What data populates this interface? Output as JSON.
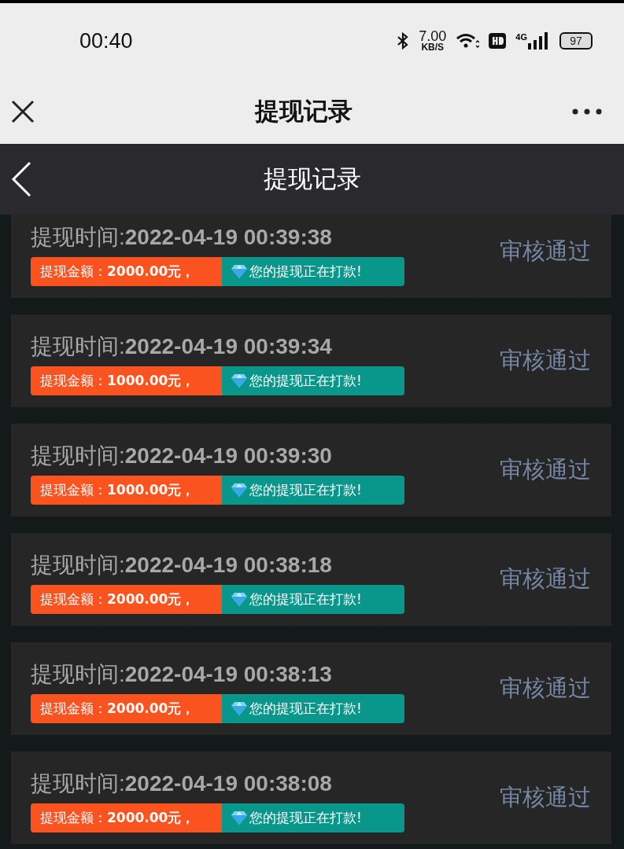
{
  "status_bar": {
    "time": "00:40",
    "speed_value": "7.00",
    "speed_unit": "KB/S",
    "network": "4G",
    "battery": "97"
  },
  "title_bar": {
    "title": "提现记录"
  },
  "header": {
    "title": "提现记录"
  },
  "records": [
    {
      "time": "提现时间:**2022-04-19 00:39:38**",
      "amount": "提现金额：**2000.00元，**",
      "message": "您的提现正在打款!",
      "status": "审核通过"
    },
    {
      "time": "提现时间:**2022-04-19 00:39:34**",
      "amount": "提现金额：**1000.00元，**",
      "message": "您的提现正在打款!",
      "status": "审核通过"
    },
    {
      "time": "提现时间:**2022-04-19 00:39:30**",
      "amount": "提现金额：**1000.00元，**",
      "message": "您的提现正在打款!",
      "status": "审核通过"
    },
    {
      "time": "提现时间:**2022-04-19 00:38:18**",
      "amount": "提现金额：**2000.00元，**",
      "message": "您的提现正在打款!",
      "status": "审核通过"
    },
    {
      "time": "提现时间:**2022-04-19 00:38:13**",
      "amount": "提现金额：**2000.00元，**",
      "message": "您的提现正在打款!",
      "status": "审核通过"
    },
    {
      "time": "提现时间:**2022-04-19 00:38:08**",
      "amount": "提现金额：**2000.00元，**",
      "message": "您的提现正在打款!",
      "status": "审核通过"
    }
  ]
}
